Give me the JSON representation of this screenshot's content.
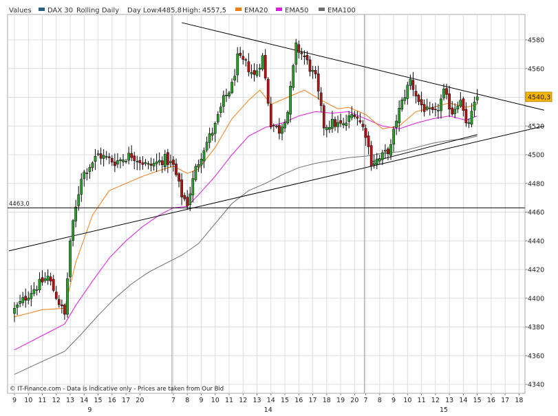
{
  "legend": {
    "values_label": "Values",
    "instrument": "DAX 30",
    "period": "Rolling Daily",
    "day_low_label": "Day Low:",
    "day_low": "4485,8",
    "high_label": "High:",
    "high": "4557,5",
    "items": [
      {
        "label": "EMA20",
        "color": "#ef7d14"
      },
      {
        "label": "EMA50",
        "color": "#dc1adc"
      },
      {
        "label": "EMA100",
        "color": "#6e6e6e"
      }
    ],
    "instrument_color": "#2a5f80"
  },
  "footer": {
    "copyright": "© IT-Finance.com - Data is indicative only - Prices are taken from Our Bid"
  },
  "chart_data": {
    "type": "candlestick",
    "ylim": [
      4330,
      4592
    ],
    "yticks": [
      4340,
      4360,
      4380,
      4400,
      4420,
      4440,
      4460,
      4480,
      4500,
      4520,
      4540,
      4560,
      4580
    ],
    "horizontal_line": {
      "value": 4463.0,
      "label": "4463,0"
    },
    "last_price": {
      "value": 4540.3,
      "label": "4540,3"
    },
    "x_ticks": [
      {
        "label": "9",
        "bar": 0
      },
      {
        "label": "10",
        "bar": 5
      },
      {
        "label": "11",
        "bar": 10
      },
      {
        "label": "12",
        "bar": 15
      },
      {
        "label": "13",
        "bar": 20
      },
      {
        "label": "14",
        "bar": 25
      },
      {
        "label": "15",
        "bar": 30
      },
      {
        "label": "16",
        "bar": 35
      },
      {
        "label": "17",
        "bar": 40
      },
      {
        "label": "20",
        "bar": 45
      },
      {
        "label": "7",
        "bar": 57
      },
      {
        "label": "8",
        "bar": 62
      },
      {
        "label": "9",
        "bar": 67
      },
      {
        "label": "10",
        "bar": 72
      },
      {
        "label": "11",
        "bar": 77
      },
      {
        "label": "12",
        "bar": 82
      },
      {
        "label": "13",
        "bar": 87
      },
      {
        "label": "14",
        "bar": 92
      },
      {
        "label": "15",
        "bar": 97
      },
      {
        "label": "16",
        "bar": 102
      },
      {
        "label": "17",
        "bar": 107
      },
      {
        "label": "18",
        "bar": 112
      },
      {
        "label": "19",
        "bar": 117
      },
      {
        "label": "20",
        "bar": 122
      },
      {
        "label": "7",
        "bar": 126
      },
      {
        "label": "8",
        "bar": 131
      },
      {
        "label": "9",
        "bar": 136
      },
      {
        "label": "10",
        "bar": 141
      },
      {
        "label": "11",
        "bar": 146
      },
      {
        "label": "12",
        "bar": 151
      },
      {
        "label": "13",
        "bar": 156
      },
      {
        "label": "14",
        "bar": 161
      },
      {
        "label": "15",
        "bar": 166
      },
      {
        "label": "16",
        "bar": 171
      },
      {
        "label": "17",
        "bar": 176
      },
      {
        "label": "18",
        "bar": 181
      }
    ],
    "x_month_labels": [
      {
        "label": "9",
        "bar": 27
      },
      {
        "label": "14",
        "bar": 91
      },
      {
        "label": "15",
        "bar": 154
      }
    ],
    "separators": [
      57,
      126
    ],
    "anchors": [
      [
        0,
        4392
      ],
      [
        6,
        4405
      ],
      [
        12,
        4415
      ],
      [
        18,
        4388
      ],
      [
        20,
        4440
      ],
      [
        24,
        4485
      ],
      [
        30,
        4500
      ],
      [
        36,
        4495
      ],
      [
        42,
        4500
      ],
      [
        48,
        4492
      ],
      [
        54,
        4497
      ],
      [
        57,
        4492
      ],
      [
        60,
        4472
      ],
      [
        62,
        4466
      ],
      [
        65,
        4490
      ],
      [
        68,
        4505
      ],
      [
        72,
        4520
      ],
      [
        75,
        4538
      ],
      [
        78,
        4548
      ],
      [
        80,
        4567
      ],
      [
        83,
        4563
      ],
      [
        86,
        4555
      ],
      [
        89,
        4568
      ],
      [
        92,
        4522
      ],
      [
        95,
        4517
      ],
      [
        98,
        4530
      ],
      [
        101,
        4575
      ],
      [
        104,
        4568
      ],
      [
        108,
        4553
      ],
      [
        111,
        4520
      ],
      [
        114,
        4522
      ],
      [
        118,
        4520
      ],
      [
        122,
        4530
      ],
      [
        126,
        4515
      ],
      [
        128,
        4495
      ],
      [
        131,
        4497
      ],
      [
        135,
        4505
      ],
      [
        137,
        4525
      ],
      [
        140,
        4542
      ],
      [
        142,
        4552
      ],
      [
        145,
        4537
      ],
      [
        148,
        4530
      ],
      [
        151,
        4528
      ],
      [
        154,
        4543
      ],
      [
        157,
        4530
      ],
      [
        160,
        4540
      ],
      [
        162,
        4519
      ],
      [
        164,
        4528
      ],
      [
        166,
        4540
      ]
    ],
    "ema20": [
      [
        0,
        4387
      ],
      [
        10,
        4392
      ],
      [
        18,
        4393
      ],
      [
        22,
        4425
      ],
      [
        28,
        4458
      ],
      [
        34,
        4475
      ],
      [
        40,
        4480
      ],
      [
        46,
        4485
      ],
      [
        52,
        4489
      ],
      [
        57,
        4492
      ],
      [
        62,
        4487
      ],
      [
        66,
        4490
      ],
      [
        72,
        4505
      ],
      [
        78,
        4525
      ],
      [
        84,
        4538
      ],
      [
        88,
        4545
      ],
      [
        92,
        4535
      ],
      [
        98,
        4540
      ],
      [
        104,
        4545
      ],
      [
        110,
        4538
      ],
      [
        116,
        4532
      ],
      [
        120,
        4533
      ],
      [
        126,
        4528
      ],
      [
        132,
        4518
      ],
      [
        138,
        4520
      ],
      [
        144,
        4530
      ],
      [
        150,
        4533
      ],
      [
        156,
        4536
      ],
      [
        162,
        4533
      ],
      [
        166,
        4535
      ]
    ],
    "ema50": [
      [
        0,
        4364
      ],
      [
        10,
        4374
      ],
      [
        18,
        4382
      ],
      [
        22,
        4395
      ],
      [
        28,
        4412
      ],
      [
        34,
        4428
      ],
      [
        40,
        4440
      ],
      [
        46,
        4450
      ],
      [
        52,
        4458
      ],
      [
        57,
        4463
      ],
      [
        62,
        4464
      ],
      [
        66,
        4472
      ],
      [
        72,
        4485
      ],
      [
        78,
        4500
      ],
      [
        84,
        4513
      ],
      [
        90,
        4519
      ],
      [
        96,
        4522
      ],
      [
        102,
        4527
      ],
      [
        108,
        4530
      ],
      [
        114,
        4529
      ],
      [
        120,
        4530
      ],
      [
        126,
        4525
      ],
      [
        132,
        4520
      ],
      [
        138,
        4518
      ],
      [
        144,
        4522
      ],
      [
        150,
        4525
      ],
      [
        156,
        4527
      ],
      [
        162,
        4524
      ],
      [
        166,
        4527
      ]
    ],
    "ema100": [
      [
        0,
        4347
      ],
      [
        10,
        4356
      ],
      [
        18,
        4363
      ],
      [
        24,
        4375
      ],
      [
        30,
        4388
      ],
      [
        36,
        4400
      ],
      [
        42,
        4410
      ],
      [
        48,
        4418
      ],
      [
        54,
        4424
      ],
      [
        60,
        4430
      ],
      [
        66,
        4438
      ],
      [
        72,
        4452
      ],
      [
        78,
        4466
      ],
      [
        84,
        4475
      ],
      [
        90,
        4480
      ],
      [
        96,
        4486
      ],
      [
        102,
        4491
      ],
      [
        108,
        4494
      ],
      [
        114,
        4496
      ],
      [
        120,
        4498
      ],
      [
        126,
        4499
      ],
      [
        132,
        4501
      ],
      [
        138,
        4502
      ],
      [
        144,
        4505
      ],
      [
        150,
        4508
      ],
      [
        156,
        4510
      ],
      [
        162,
        4511
      ],
      [
        166,
        4513
      ]
    ],
    "trendlines": [
      {
        "from": [
          -2,
          4433
        ],
        "to": [
          190,
          4520
        ]
      },
      {
        "from": [
          60,
          4592
        ],
        "to": [
          190,
          4531
        ]
      },
      {
        "from": [
          128,
          4495
        ],
        "to": [
          166,
          4514
        ]
      }
    ],
    "colors": {
      "up": "#2aa12a",
      "down": "#b31414",
      "wick": "#000000",
      "frame": "#a7a7a7",
      "grid": "#d9dde2",
      "plot_bg": "#ffffff",
      "trend": "#000000"
    }
  }
}
